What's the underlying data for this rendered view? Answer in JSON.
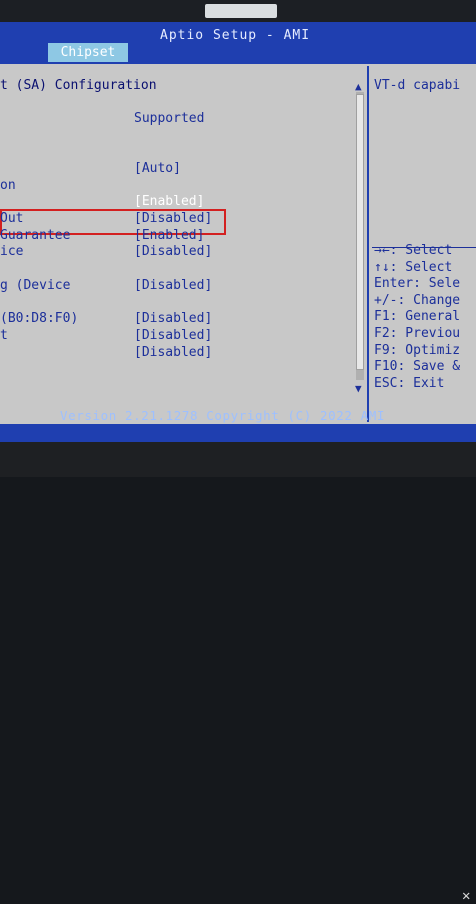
{
  "header": {
    "title": "Aptio Setup - AMI",
    "tab": "Chipset"
  },
  "settings": {
    "section_title": "t (SA) Configuration",
    "rows": [
      {
        "label": "",
        "value": "Supported"
      },
      {
        "label": "",
        "value": "[Auto]"
      },
      {
        "label": "on",
        "value": ""
      },
      {
        "label": "",
        "value": "[Enabled]"
      },
      {
        "label": "Out",
        "value": "[Disabled]"
      },
      {
        "label": " Guarantee",
        "value": "[Enabled]"
      },
      {
        "label": "ice",
        "value": "[Disabled]"
      },
      {
        "label": "g (Device",
        "value": "[Disabled]"
      },
      {
        "label": "(B0:D8:F0)",
        "value": "[Disabled]"
      },
      {
        "label": "t",
        "value": "[Disabled]"
      },
      {
        "label": "",
        "value": "[Disabled]"
      }
    ]
  },
  "help_panel": {
    "description": "VT-d capabi",
    "keys": [
      "→←: Select",
      "↑↓: Select",
      "Enter: Sele",
      "+/-: Change",
      "F1: General",
      "F2: Previou",
      "F9: Optimiz",
      "F10: Save &",
      "ESC: Exit"
    ]
  },
  "footer": {
    "text": "Version 2.21.1278 Copyright (C) 2022 AMI"
  },
  "icons": {
    "scroll_up": "scroll-up-arrow",
    "scroll_down": "scroll-down-arrow"
  },
  "colors": {
    "screen_blue": "#1f3fb0",
    "panel_gray": "#c8c8c8",
    "text_blue": "#1c2f9a",
    "highlight_red": "#d32020"
  }
}
